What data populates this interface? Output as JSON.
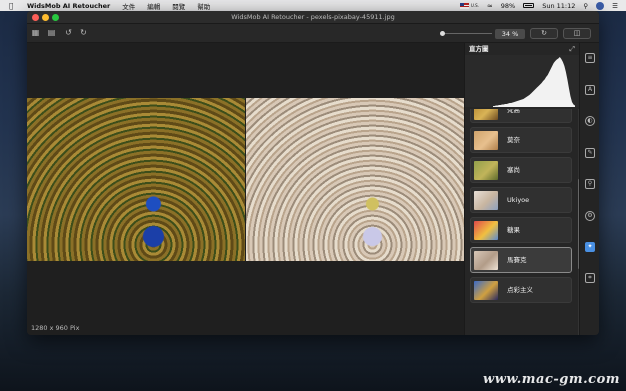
{
  "menubar": {
    "app_name": "WidsMob AI Retoucher",
    "menus": [
      "文件",
      "編輯",
      "閱覽",
      "幫助"
    ],
    "input_source": "U.S.",
    "battery": "98%",
    "time": "Sun 11:12"
  },
  "window": {
    "title": "WidsMob AI Retoucher - pexels-pixabay-45911.jpg"
  },
  "toolbar": {
    "zoom": "34 %"
  },
  "canvas": {
    "image_info": "1280 x 960 Pix"
  },
  "panel": {
    "title": "直方圖",
    "histogram": [
      2,
      2,
      3,
      3,
      4,
      4,
      5,
      5,
      6,
      6,
      7,
      8,
      8,
      9,
      10,
      11,
      12,
      13,
      14,
      15,
      16,
      18,
      20,
      22,
      24,
      27,
      30,
      33,
      36,
      39,
      42,
      45,
      48,
      52,
      55,
      60,
      64,
      70,
      76,
      82,
      88,
      92,
      95,
      97,
      100,
      96,
      90,
      82,
      70,
      55,
      38,
      22,
      10,
      5,
      3
    ],
    "filters": [
      {
        "label": "梵高",
        "colors": [
          "#b2852f",
          "#d9b356",
          "#6e4b21"
        ]
      },
      {
        "label": "莫奈",
        "colors": [
          "#d1a46c",
          "#e7c08e",
          "#b07f4b"
        ]
      },
      {
        "label": "塞尚",
        "colors": [
          "#93a04b",
          "#c1b45a",
          "#5d6b2c"
        ]
      },
      {
        "label": "Ukiyoe",
        "colors": [
          "#e8e0d8",
          "#c8b5a0",
          "#8ca0c0"
        ]
      },
      {
        "label": "糖果",
        "colors": [
          "#e04a4a",
          "#f0c040",
          "#5a8ad0"
        ]
      },
      {
        "label": "馬賽克",
        "colors": [
          "#d7c7b8",
          "#b29c88",
          "#eee2d5"
        ]
      },
      {
        "label": "点彩主义",
        "colors": [
          "#3a6ac8",
          "#d0a040",
          "#2a2a60"
        ]
      }
    ],
    "selected_index": 5
  },
  "sidebar": {
    "icons": [
      "adjust-icon",
      "ai-icon",
      "color-icon",
      "brush-icon",
      "search-icon",
      "gear-icon",
      "effects-icon",
      "crop-icon"
    ]
  },
  "watermark": "www.mac-gm.com"
}
